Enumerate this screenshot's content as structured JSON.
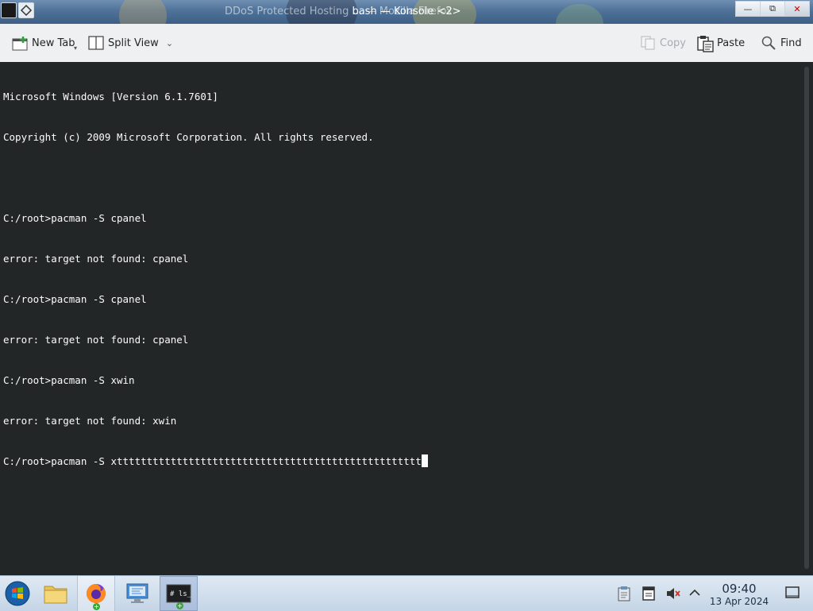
{
  "window": {
    "title": "bash — Konsole <2>",
    "background_title": "DDoS Protected Hosting … — Mozilla Firefox"
  },
  "toolbar": {
    "new_tab": "New Tab",
    "split_view": "Split View",
    "copy": "Copy",
    "paste": "Paste",
    "find": "Find"
  },
  "terminal": {
    "lines": [
      "Microsoft Windows [Version 6.1.7601]",
      "Copyright (c) 2009 Microsoft Corporation. All rights reserved.",
      "",
      "C:/root>pacman -S cpanel",
      "error: target not found: cpanel",
      "C:/root>pacman -S cpanel",
      "error: target not found: cpanel",
      "C:/root>pacman -S xwin",
      "error: target not found: xwin"
    ],
    "current_input": "C:/root>pacman -S xttttttttttttttttttttttttttttttttttttttttttttttttttt"
  },
  "taskbar": {
    "apps": [
      "start-orb-icon",
      "file-manager-icon",
      "firefox-icon",
      "system-settings-icon",
      "terminal-icon"
    ],
    "clock_time": "09:40",
    "clock_date": "13 Apr 2024"
  },
  "colors": {
    "terminal_bg": "#232627",
    "terminal_fg": "#fcfcfc",
    "toolbar_bg": "#eff0f1",
    "taskbar_bg": "#d3e0ee"
  }
}
